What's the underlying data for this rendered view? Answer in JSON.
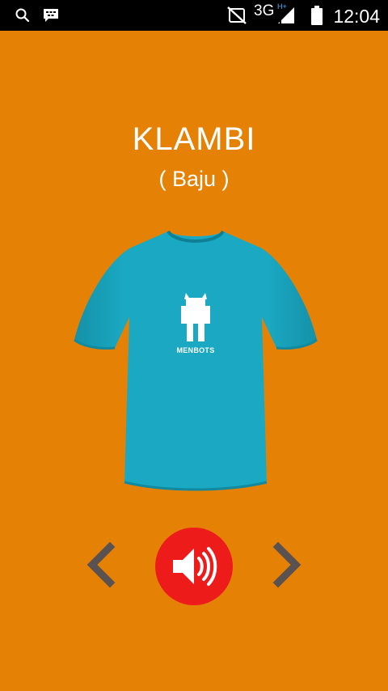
{
  "status_bar": {
    "time": "12:04",
    "network": "3G",
    "network_sub": "H+",
    "icons": [
      "search-icon",
      "bbm-icon",
      "mute-icon",
      "signal-icon",
      "battery-icon"
    ]
  },
  "card": {
    "title": "KLAMBI",
    "translation": "( Baju )",
    "image_icon": "tshirt-image",
    "shirt_logo_text": "MENBOTS"
  },
  "controls": {
    "prev_icon": "chevron-left-icon",
    "play_icon": "speaker-icon",
    "next_icon": "chevron-right-icon"
  },
  "colors": {
    "background": "#e58206",
    "shirt": "#1aa8c2",
    "play_button": "#ee1b1b",
    "chevrons": "#5a5250"
  }
}
